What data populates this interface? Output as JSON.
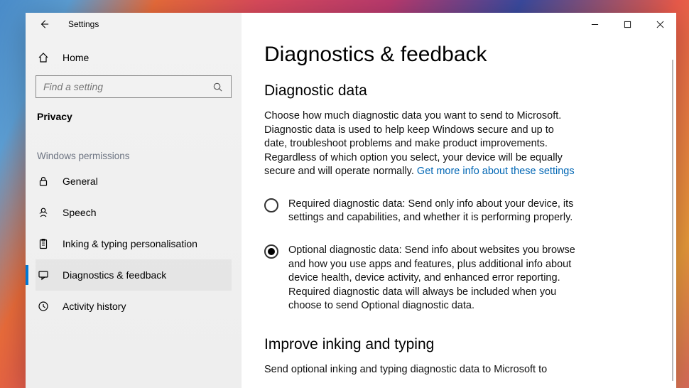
{
  "app_title": "Settings",
  "home_label": "Home",
  "search": {
    "placeholder": "Find a setting"
  },
  "section_title": "Privacy",
  "group_label": "Windows permissions",
  "nav": {
    "general": "General",
    "speech": "Speech",
    "inking": "Inking & typing personalisation",
    "diagnostics": "Diagnostics & feedback",
    "activity": "Activity history"
  },
  "page": {
    "title": "Diagnostics & feedback",
    "h2_data": "Diagnostic data",
    "desc_prefix": "Choose how much diagnostic data you want to send to Microsoft. Diagnostic data is used to help keep Windows secure and up to date, troubleshoot problems and make product improvements. Regardless of which option you select, your device will be equally secure and will operate normally. ",
    "link_text": "Get more info about these settings",
    "opt_required": "Required diagnostic data: Send only info about your device, its settings and capabilities, and whether it is performing properly.",
    "opt_optional": "Optional diagnostic data: Send info about websites you browse and how you use apps and features, plus additional info about device health, device activity, and enhanced error reporting. Required diagnostic data will always be included when you choose to send Optional diagnostic data.",
    "h2_inking": "Improve inking and typing",
    "inking_desc": "Send optional inking and typing diagnostic data to Microsoft to"
  }
}
